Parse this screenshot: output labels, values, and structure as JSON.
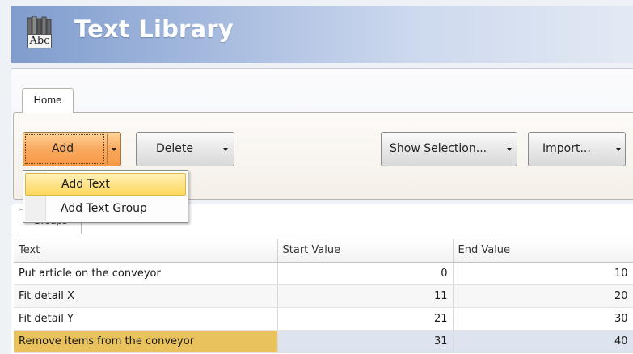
{
  "app": {
    "title": "Text Library",
    "icon_label": "Abc",
    "icon": "books-icon"
  },
  "ribbon": {
    "tabs": [
      {
        "label": "Home",
        "active": true
      }
    ],
    "buttons": {
      "add": "Add",
      "delete": "Delete",
      "show_selection": "Show Selection...",
      "import": "Import..."
    }
  },
  "add_menu": {
    "open": true,
    "items": [
      {
        "label": "Add Text",
        "highlighted": true
      },
      {
        "label": "Add Text Group",
        "highlighted": false
      }
    ]
  },
  "lower_tabs": [
    {
      "label": "Groups"
    }
  ],
  "table": {
    "columns": [
      "Text",
      "Start Value",
      "End Value"
    ],
    "rows": [
      {
        "text": "Put article on the conveyor",
        "start": "0",
        "end": "10",
        "selected": false
      },
      {
        "text": "Fit detail X",
        "start": "11",
        "end": "20",
        "selected": false
      },
      {
        "text": "Fit detail Y",
        "start": "21",
        "end": "30",
        "selected": false
      },
      {
        "text": "Remove items from the conveyor",
        "start": "31",
        "end": "40",
        "selected": true
      }
    ]
  },
  "colors": {
    "banner_start": "#7f9ccd",
    "banner_end": "#e3e9f4",
    "add_button": "#f79845",
    "menu_highlight": "#ffe38a",
    "row_selected": "#e9c25e"
  }
}
